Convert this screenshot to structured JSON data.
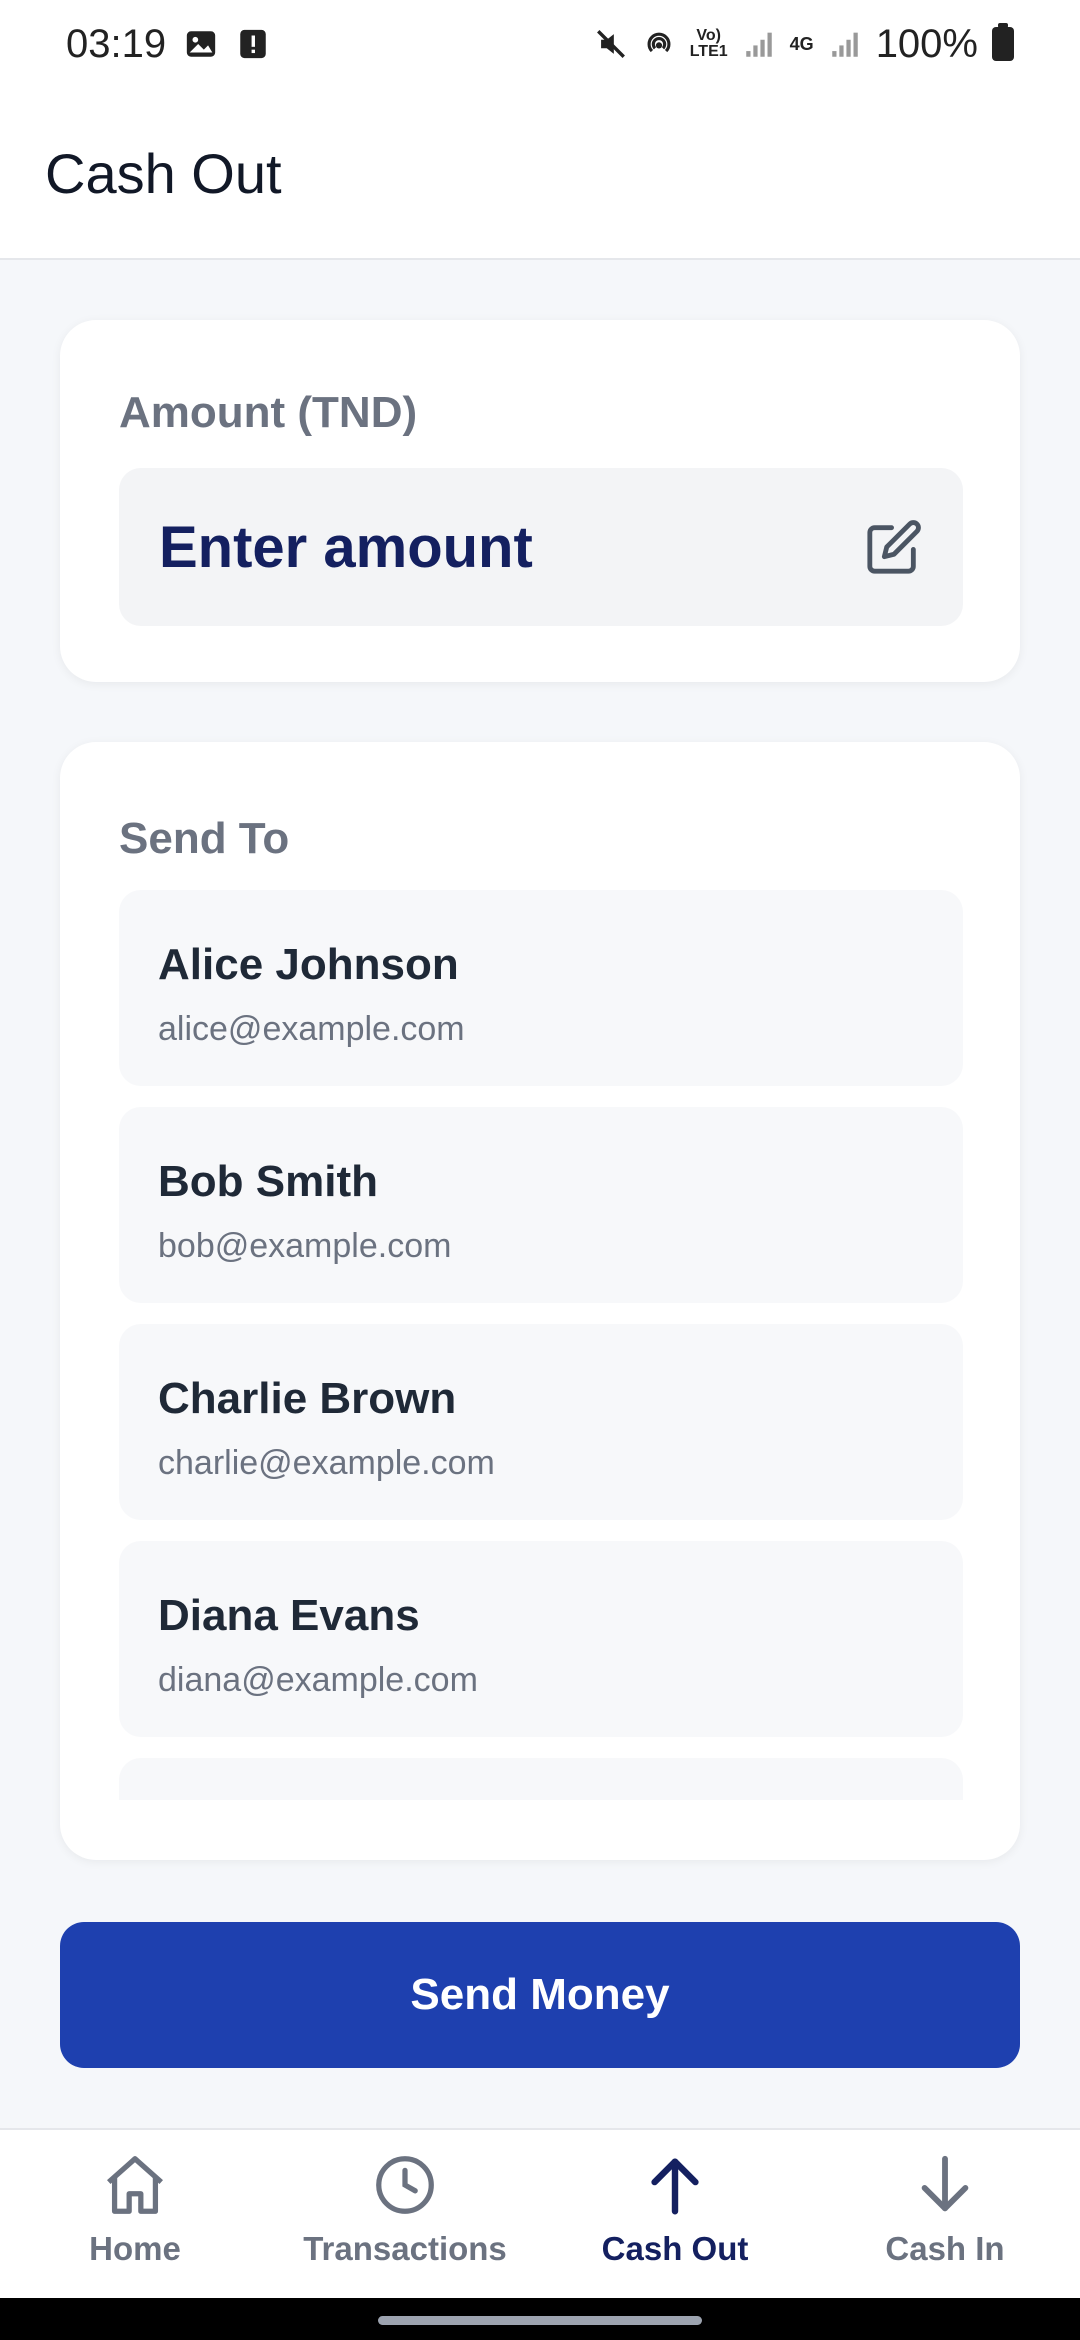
{
  "status_bar": {
    "time": "03:19",
    "battery": "100%",
    "icons_left": [
      "image-icon",
      "alert-icon"
    ],
    "icons_right": [
      "mute-icon",
      "hotspot-icon",
      "volte-icon",
      "signal-icon",
      "4g-icon",
      "signal-icon",
      "battery-icon"
    ],
    "volte_text": "Vo) LTE1",
    "network_text": "4G"
  },
  "header": {
    "title": "Cash Out"
  },
  "amount": {
    "label": "Amount (TND)",
    "placeholder": "Enter amount",
    "value": "",
    "icon": "edit-icon"
  },
  "send_to": {
    "label": "Send To",
    "recipients": [
      {
        "name": "Alice Johnson",
        "email": "alice@example.com"
      },
      {
        "name": "Bob Smith",
        "email": "bob@example.com"
      },
      {
        "name": "Charlie Brown",
        "email": "charlie@example.com"
      },
      {
        "name": "Diana Evans",
        "email": "diana@example.com"
      },
      {
        "name": "",
        "email": ""
      }
    ]
  },
  "send_button": {
    "label": "Send Money"
  },
  "bottom_nav": {
    "items": [
      {
        "label": "Home",
        "icon": "home-icon",
        "active": false
      },
      {
        "label": "Transactions",
        "icon": "clock-icon",
        "active": false
      },
      {
        "label": "Cash Out",
        "icon": "arrow-up-icon",
        "active": true
      },
      {
        "label": "Cash In",
        "icon": "arrow-down-icon",
        "active": false
      }
    ]
  },
  "colors": {
    "primary": "#1e40af",
    "active_nav": "#142060",
    "inactive_nav": "#6b7280",
    "background": "#f5f7fa"
  }
}
